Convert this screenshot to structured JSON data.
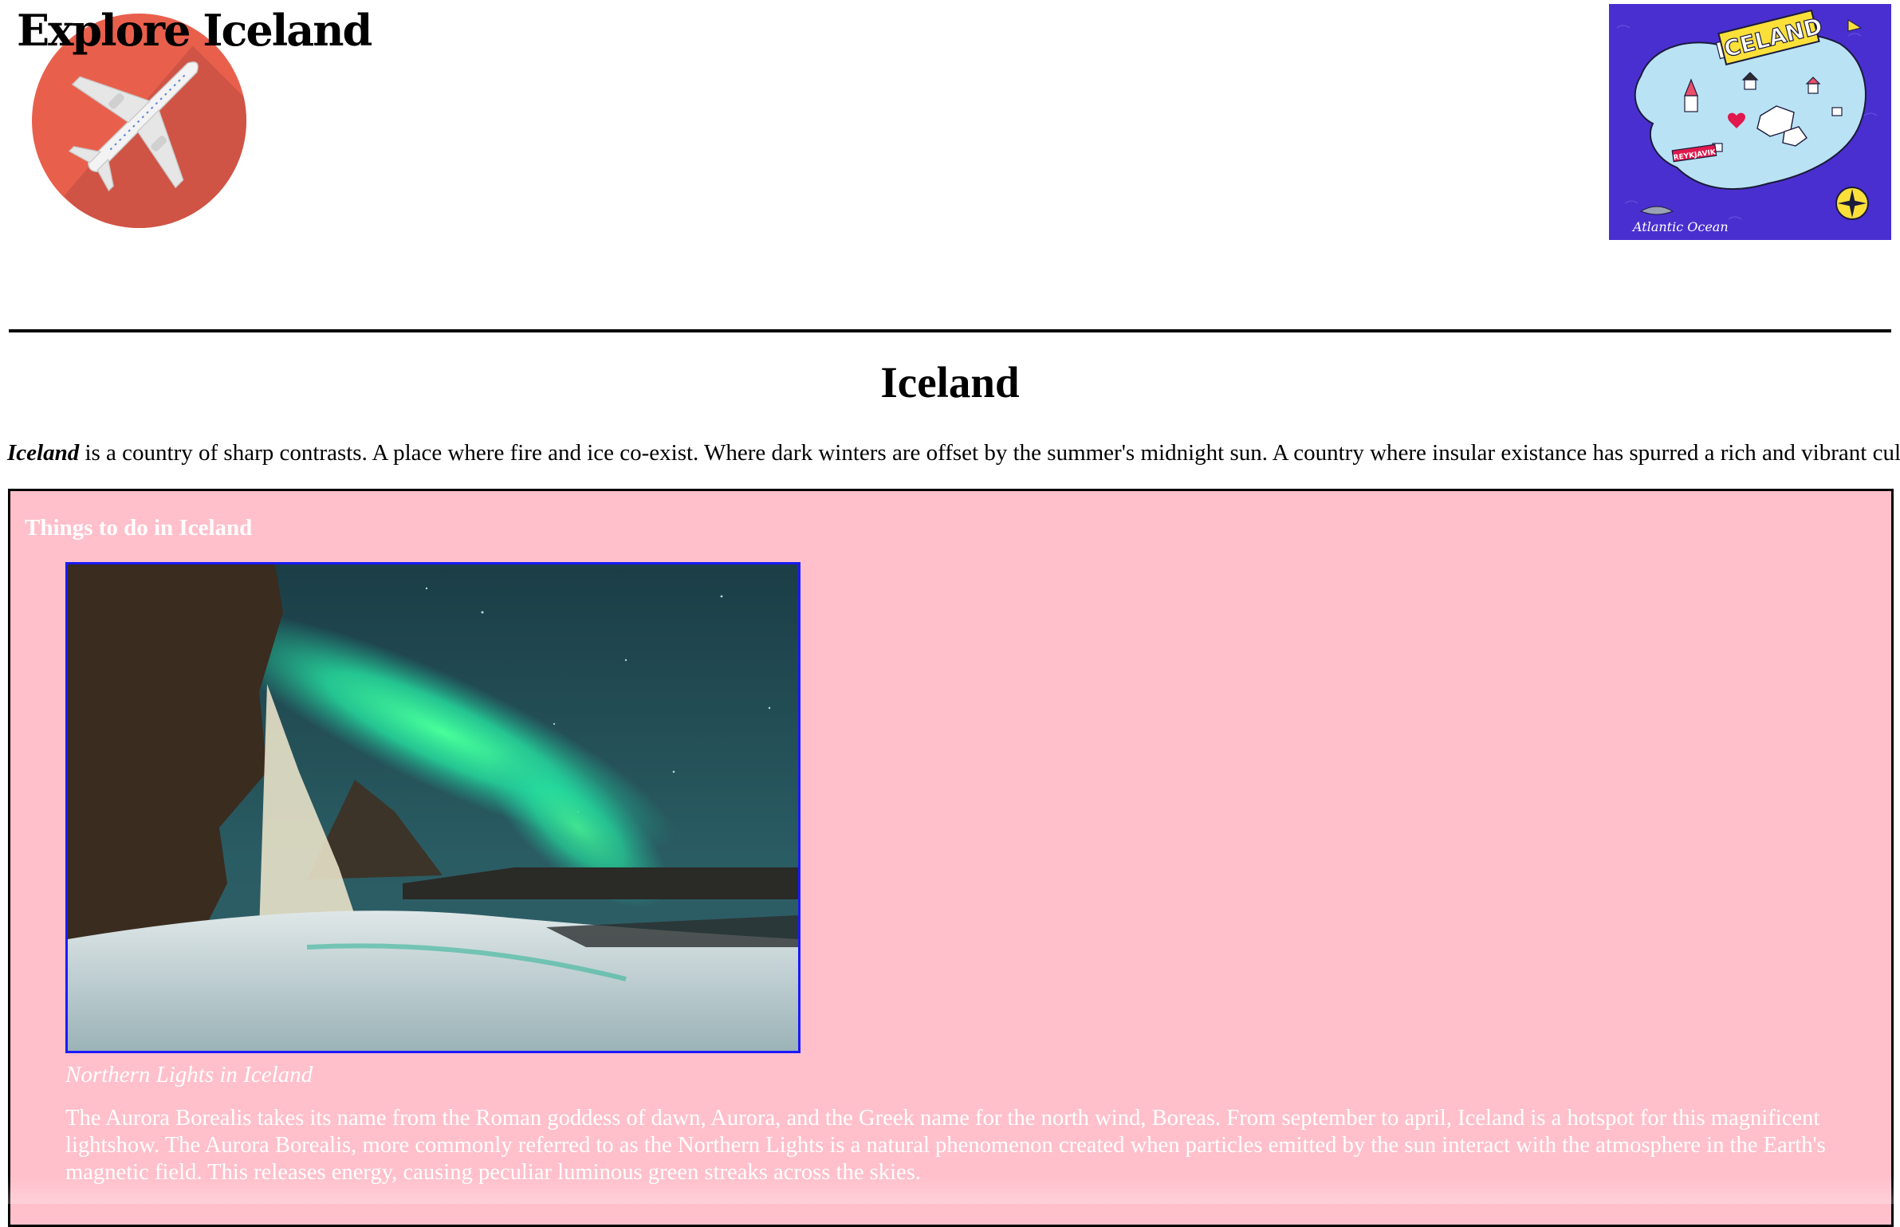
{
  "header": {
    "site_title": "Explore Iceland",
    "logo_icon": "airplane-icon",
    "map_image": {
      "label_title": "ICELAND",
      "label_city": "REYKJAVIK",
      "label_ocean": "Atlantic Ocean"
    }
  },
  "main": {
    "heading": "Iceland",
    "intro": {
      "emphasis": "Iceland",
      "text": " is a country of sharp contrasts. A place where fire and ice co-exist. Where dark winters are offset by the summer's midnight sun. A country where insular existance has spurred a rich and vibrant culture"
    }
  },
  "things_to_do": {
    "heading": "Things to do in Iceland",
    "items": [
      {
        "caption": "Northern Lights in Iceland",
        "description": "The Aurora Borealis takes its name from the Roman goddess of dawn, Aurora, and the Greek name for the north wind, Boreas. From september to april, Iceland is a hotspot for this magnificent lightshow. The Aurora Borealis, more commonly referred to as the Northern Lights is a natural phenomenon created when particles emitted by the sun interact with the atmosphere in the Earth's magnetic field. This releases energy, causing peculiar luminous green streaks across the skies."
      }
    ]
  },
  "colors": {
    "section_background": "#ffc0cb",
    "logo_circle": "#e8604c",
    "map_background": "#4a2fd0",
    "image_border": "#1a1aff"
  }
}
